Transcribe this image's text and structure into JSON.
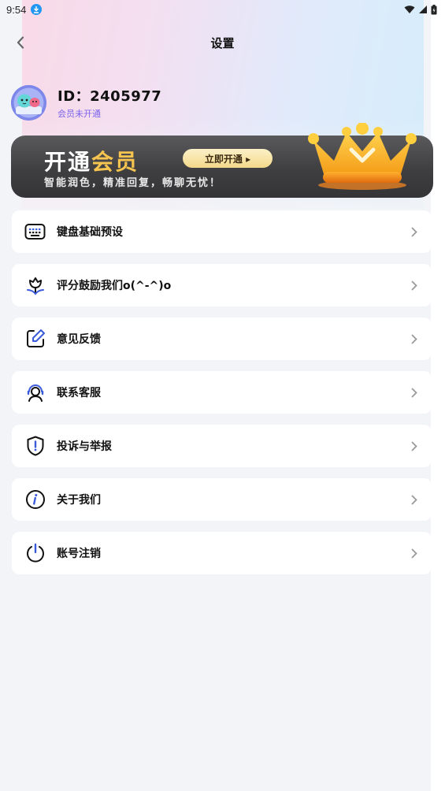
{
  "status_bar": {
    "time": "9:54",
    "icons": [
      "download-notification-icon",
      "wifi-icon",
      "signal-icon",
      "battery-icon"
    ]
  },
  "header": {
    "title": "设置",
    "back_icon": "chevron-left-icon"
  },
  "profile": {
    "id_label": "ID：2405977",
    "member_status": "会员未开通"
  },
  "vip_banner": {
    "title_white": "开通",
    "title_gold": "会员",
    "button_label": "立即开通 ▸",
    "subtitle": "智能润色，精准回复，畅聊无忧！"
  },
  "menu": [
    {
      "label": "键盘基础预设",
      "icon": "keyboard-icon"
    },
    {
      "label": "评分鼓励我们o(^-^)o",
      "icon": "flower-icon"
    },
    {
      "label": "意见反馈",
      "icon": "edit-icon"
    },
    {
      "label": "联系客服",
      "icon": "customer-service-icon"
    },
    {
      "label": "投诉与举报",
      "icon": "shield-alert-icon"
    },
    {
      "label": "关于我们",
      "icon": "info-icon"
    },
    {
      "label": "账号注销",
      "icon": "power-icon"
    }
  ],
  "colors": {
    "accent_purple": "#7b62ea",
    "vip_gold": "#f6c44f",
    "banner_dark": "#3f3f41"
  }
}
